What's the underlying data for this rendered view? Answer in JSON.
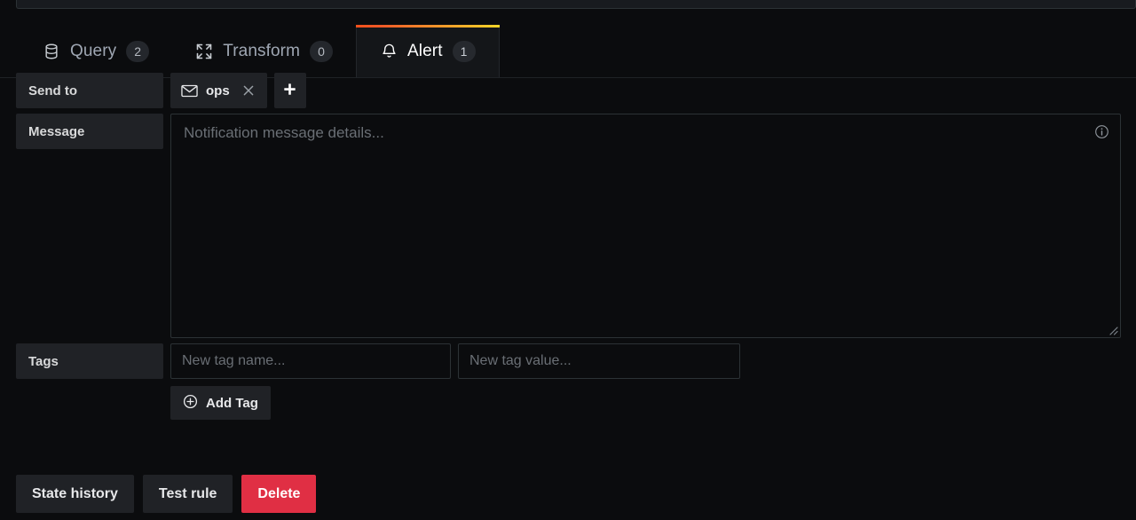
{
  "panel": {
    "tabs": [
      {
        "label": "Query",
        "badge": "2",
        "icon": "database-icon",
        "active": false
      },
      {
        "label": "Transform",
        "badge": "0",
        "icon": "transform-icon",
        "active": false
      },
      {
        "label": "Alert",
        "badge": "1",
        "icon": "bell-icon",
        "active": true
      }
    ],
    "active_tab_accent_start": "#f2501b",
    "active_tab_accent_end": "#f5d628"
  },
  "alert_form": {
    "send_to": {
      "label": "Send to",
      "channels": [
        {
          "name": "ops",
          "icon": "envelope-icon",
          "remove_icon": "close-icon"
        }
      ],
      "add_icon": "plus-icon"
    },
    "message": {
      "label": "Message",
      "value": "",
      "placeholder": "Notification message details...",
      "info_icon": "info-circle-icon",
      "resize_icon": "resize-grip-icon"
    },
    "tags": {
      "label": "Tags",
      "name_value": "",
      "name_placeholder": "New tag name...",
      "value_value": "",
      "value_placeholder": "New tag value...",
      "add_tag_label": "Add Tag",
      "add_tag_icon": "plus-circle-icon"
    }
  },
  "footer": {
    "state_history_label": "State history",
    "test_rule_label": "Test rule",
    "delete_label": "Delete",
    "delete_color": "#e02f44"
  }
}
